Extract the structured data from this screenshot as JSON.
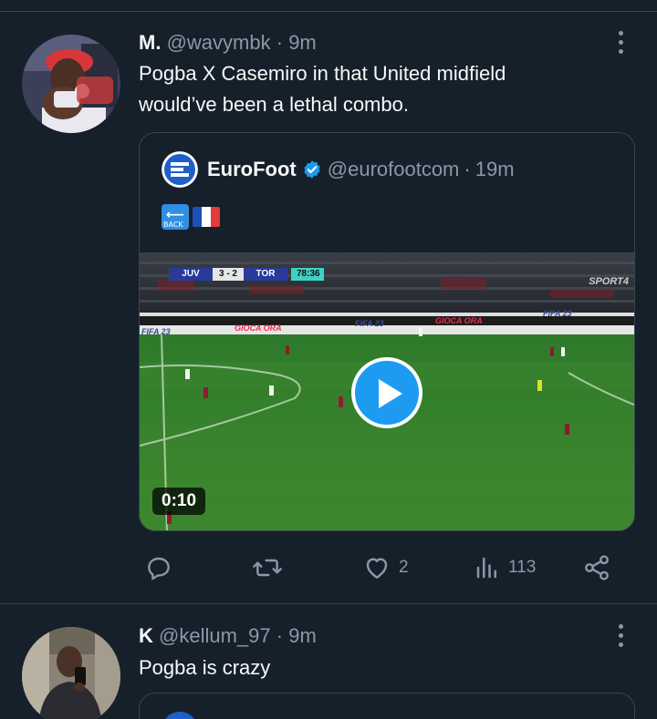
{
  "tweets": [
    {
      "name": "M.",
      "handle": "@wavymbk",
      "separator": "·",
      "time": "9m",
      "text_lines": [
        "Pogba X Casemiro in that United midfield",
        "would’ve been a lethal combo."
      ],
      "quote": {
        "name": "EuroFoot",
        "handle": "@eurofootcom",
        "separator": "·",
        "time": "19m",
        "emojis": [
          "back-arrow-emoji",
          "france-flag-emoji"
        ],
        "emoji_back_text": "BACK",
        "video": {
          "duration": "0:10",
          "scoreboard": {
            "home": "JUV",
            "score": "3 - 2",
            "away": "TOR",
            "clock": "78:36"
          },
          "channel": "SPORT4",
          "boards": [
            "FIFA 23",
            "GIOCA ORA"
          ]
        }
      },
      "actions": {
        "reply": "",
        "retweet": "",
        "like": "2",
        "views": "113",
        "share": ""
      }
    },
    {
      "name": "K",
      "handle": "@kellum_97",
      "separator": "·",
      "time": "9m",
      "text_lines": [
        "Pogba is crazy"
      ]
    }
  ],
  "colors": {
    "background": "#15202b",
    "accent": "#1d9bf0",
    "muted": "#8b98a5",
    "divider": "#38444d",
    "pitch": "#3f8a2e"
  },
  "icons": [
    "more-icon",
    "verified-badge-icon",
    "play-icon",
    "reply-icon",
    "retweet-icon",
    "like-icon",
    "views-icon",
    "share-icon"
  ]
}
